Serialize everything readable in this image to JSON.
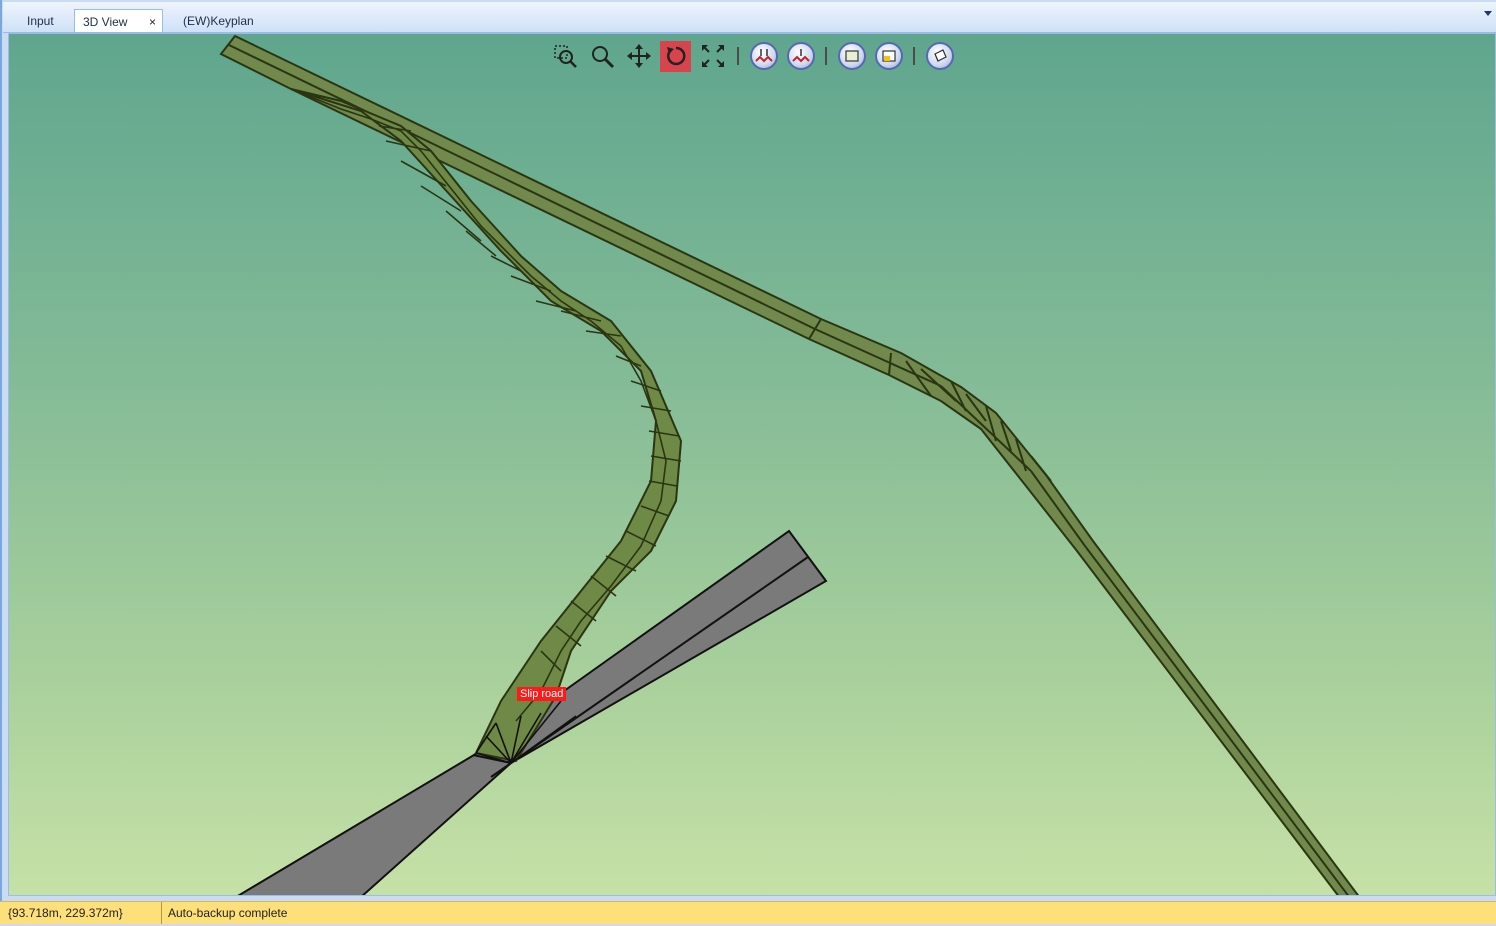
{
  "tabs": [
    {
      "label": "Input"
    },
    {
      "label": "3D View",
      "close": "×"
    },
    {
      "label": "(EW)Keyplan"
    }
  ],
  "toolbar": {
    "buttons": [
      {
        "icon": "zoom-window-icon"
      },
      {
        "icon": "zoom-icon"
      },
      {
        "icon": "pan-icon"
      },
      {
        "icon": "rotate-icon",
        "active": true
      },
      {
        "icon": "zoom-extents-icon"
      },
      {
        "icon": "view-elevation-1-icon"
      },
      {
        "icon": "view-elevation-2-icon"
      },
      {
        "icon": "view-plan-icon"
      },
      {
        "icon": "view-edit-icon"
      },
      {
        "icon": "view-3d-icon"
      }
    ]
  },
  "scene": {
    "label": "Slip road"
  },
  "status": {
    "coords": "{93.718m, 229.372m}",
    "message": "Auto-backup complete"
  },
  "colors": {
    "road_fill": "#6f8b4c",
    "road_stroke": "#2d3a14",
    "main_road_fill": "#7b7b7b",
    "label_bg": "#ff1a1a",
    "status_bg": "#fde07a"
  }
}
